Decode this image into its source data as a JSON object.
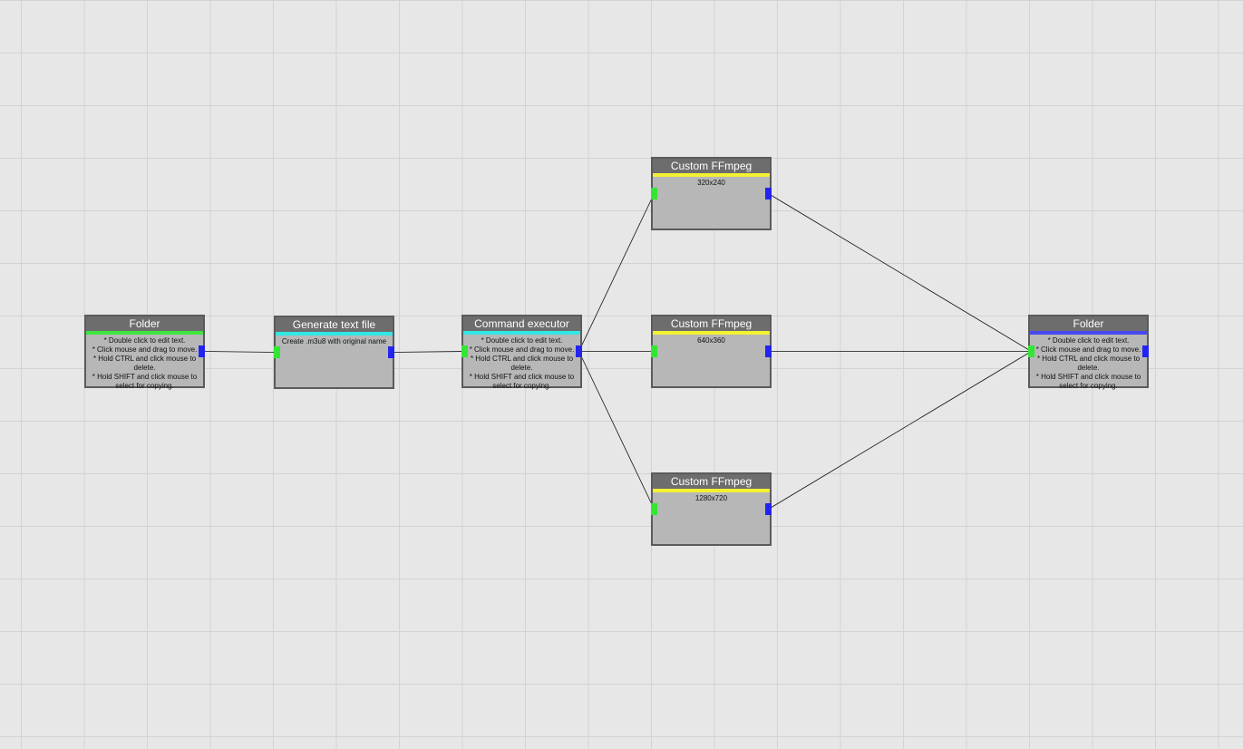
{
  "colors": {
    "background": "#e7e7e7",
    "grid_line": "#d3d3d3",
    "node_body": "#b7b7b7",
    "node_title": "#6d6d6d",
    "node_border": "#5b5b5b",
    "port_input": "#33e633",
    "port_output": "#2323f2",
    "wire": "#111111"
  },
  "help_lines": [
    "* Double click to edit text.",
    "* Click mouse and drag to move.",
    "* Hold CTRL and click mouse to delete.",
    "* Hold SHIFT and click mouse to select for copying."
  ],
  "nodes": [
    {
      "id": "folder-source",
      "title": "Folder",
      "accent": "#3ee63e",
      "body": "help"
    },
    {
      "id": "generate-text-file",
      "title": "Generate text file",
      "accent": "#33e6e6",
      "body": "Create .m3u8 with original name"
    },
    {
      "id": "command-executor",
      "title": "Command executor",
      "accent": "#33e6e6",
      "body": "help"
    },
    {
      "id": "ffmpeg-320",
      "title": "Custom FFmpeg",
      "accent": "#f2f233",
      "body": "320x240"
    },
    {
      "id": "ffmpeg-640",
      "title": "Custom FFmpeg",
      "accent": "#f2f233",
      "body": "640x360"
    },
    {
      "id": "ffmpeg-1280",
      "title": "Custom FFmpeg",
      "accent": "#f2f233",
      "body": "1280x720"
    },
    {
      "id": "folder-output",
      "title": "Folder",
      "accent": "#4848ef",
      "body": "help"
    }
  ],
  "connections": [
    {
      "from": "folder-source",
      "to": "generate-text-file"
    },
    {
      "from": "generate-text-file",
      "to": "command-executor"
    },
    {
      "from": "command-executor",
      "to": "ffmpeg-320"
    },
    {
      "from": "command-executor",
      "to": "ffmpeg-640"
    },
    {
      "from": "command-executor",
      "to": "ffmpeg-1280"
    },
    {
      "from": "ffmpeg-320",
      "to": "folder-output"
    },
    {
      "from": "ffmpeg-640",
      "to": "folder-output"
    },
    {
      "from": "ffmpeg-1280",
      "to": "folder-output"
    }
  ]
}
